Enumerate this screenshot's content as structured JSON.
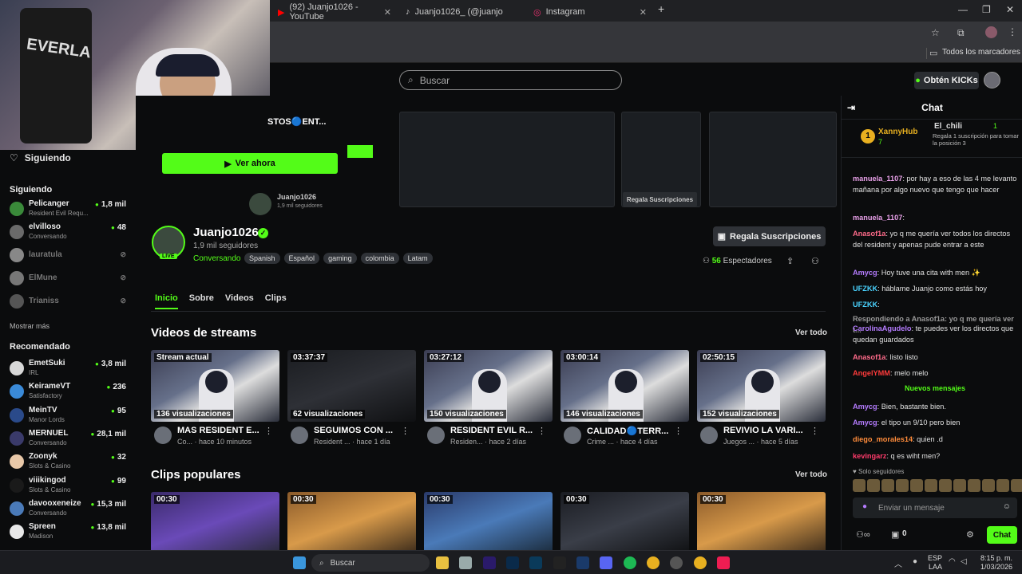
{
  "browser": {
    "tabs": [
      {
        "title": "(92) Juanjo1026 - YouTube",
        "icon": "youtube-icon"
      },
      {
        "title": "Juanjo1026_ (@juanjo1026_) | T",
        "icon": "tiktok-icon"
      },
      {
        "title": "Instagram",
        "icon": "instagram-icon"
      }
    ],
    "bookmarks_label": "Todos los marcadores"
  },
  "topbar": {
    "search_placeholder": "Buscar",
    "get_kicks_label": "Obtén KICKs"
  },
  "banner": {
    "title_fragment": "STOS🔵ENT...",
    "watch_now": "Ver ahora",
    "regala_small": "Regala Suscripciones",
    "small_name": "Juanjo1026",
    "small_followers": "1,9 mil seguidores"
  },
  "sidebar": {
    "siguiendo_header": "Siguiendo",
    "following_title": "Siguiendo",
    "following": [
      {
        "name": "Pelicanger",
        "game": "Resident Evil Requ...",
        "count": "1,8 mil",
        "live": true
      },
      {
        "name": "elvilloso",
        "game": "Conversando",
        "count": "48",
        "live": true
      },
      {
        "name": "lauratula",
        "game": "",
        "count": "",
        "live": false
      },
      {
        "name": "ElMune",
        "game": "",
        "count": "",
        "live": false
      },
      {
        "name": "Trianiss",
        "game": "",
        "count": "",
        "live": false
      }
    ],
    "show_more": "Mostrar más",
    "recommended_title": "Recomendado",
    "recommended": [
      {
        "name": "EmetSuki",
        "game": "IRL",
        "count": "3,8 mil"
      },
      {
        "name": "KeirameVT",
        "game": "Satisfactory",
        "count": "236"
      },
      {
        "name": "MeinTV",
        "game": "Manor Lords",
        "count": "95"
      },
      {
        "name": "MERNUEL",
        "game": "Conversando",
        "count": "28,1 mil"
      },
      {
        "name": "Zoonyk",
        "game": "Slots & Casino",
        "count": "32"
      },
      {
        "name": "viiikingod",
        "game": "Slots & Casino",
        "count": "99"
      },
      {
        "name": "davooxeneize",
        "game": "Conversando",
        "count": "15,3 mil"
      },
      {
        "name": "Spreen",
        "game": "Madison",
        "count": "13,8 mil"
      }
    ]
  },
  "profile": {
    "name": "Juanjo1026",
    "followers": "1,9 mil seguidores",
    "status": "Conversando",
    "live_badge": "LIVE",
    "tags": [
      "Spanish",
      "Español",
      "gaming",
      "colombia",
      "Latam"
    ],
    "regala_btn": "Regala Suscripciones",
    "viewers_count": "56",
    "viewers_label": "Espectadores"
  },
  "tabs": [
    "Inicio",
    "Sobre",
    "Videos",
    "Clips"
  ],
  "videos_section": {
    "title": "Videos de streams",
    "see_all": "Ver todo",
    "items": [
      {
        "badge": "Stream actual",
        "views": "136 visualizaciones",
        "title": "MAS RESIDENT E...",
        "sub": "Co... · hace 10 minutos"
      },
      {
        "badge": "03:37:37",
        "views": "62 visualizaciones",
        "title": "SEGUIMOS CON ...",
        "sub": "Resident ... · hace 1 día"
      },
      {
        "badge": "03:27:12",
        "views": "150 visualizaciones",
        "title": "RESIDENT EVIL R...",
        "sub": "Residen... · hace 2 días"
      },
      {
        "badge": "03:00:14",
        "views": "146 visualizaciones",
        "title": "CALIDAD🔵TERR...",
        "sub": "Crime ... · hace 4 días"
      },
      {
        "badge": "02:50:15",
        "views": "152 visualizaciones",
        "title": "REVIVIO LA VARI...",
        "sub": "Juegos ... · hace 5 días"
      }
    ]
  },
  "clips_section": {
    "title": "Clips populares",
    "see_all": "Ver todo",
    "durations": [
      "00:30",
      "00:30",
      "00:30",
      "00:30",
      "00:30"
    ]
  },
  "chat": {
    "title": "Chat",
    "pinned_user1": "XannyHub",
    "pinned_count1": "7",
    "pinned_user2": "El_chili",
    "pinned_count2": "1",
    "pinned_text": "Regala 1 suscripción para tomar la posición 3",
    "messages": [
      {
        "user": "manuela_1107",
        "color": "#e8a0e8",
        "text": ": por hay a eso de las 4 me levanto mañana por algo nuevo que tengo que hacer"
      },
      {
        "user": "manuela_1107",
        "color": "#e8a0e8",
        "text": ":"
      },
      {
        "user": "Anasof1a",
        "color": "#ff6b8a",
        "text": ": yo q me quería ver todos los directos del resident y apenas pude entrar a este"
      },
      {
        "user": "Amycg",
        "color": "#b57cff",
        "text": ": Hoy tuve una cita with men ✨"
      },
      {
        "user": "UFZKK",
        "color": "#4ad3ff",
        "text": ": háblame Juanjo como estás hoy"
      },
      {
        "user": "UFZKK",
        "color": "#4ad3ff",
        "text": ":"
      },
      {
        "user": "Respondiendo a Anasof1a: yo q me quería ver t...",
        "color": "#999999",
        "text": ""
      },
      {
        "user": "CarolinaAgudelo",
        "color": "#b57cff",
        "text": ": te puedes ver los directos que quedan guardados"
      },
      {
        "user": "Anasof1a",
        "color": "#ff6b8a",
        "text": ": listo listo"
      },
      {
        "user": "AngelYMM",
        "color": "#ff3b3b",
        "text": ": melo melo"
      }
    ],
    "new_messages": "Nuevos mensajes",
    "messages2": [
      {
        "user": "Amycg",
        "color": "#b57cff",
        "text": ": Bien, bastante bien."
      },
      {
        "user": "Amycg",
        "color": "#b57cff",
        "text": ": el tipo un 9/10 pero bien"
      },
      {
        "user": "diego_morales14",
        "color": "#ff8c3b",
        "text": ": quien .d"
      },
      {
        "user": "kevingarz",
        "color": "#ff3b6b",
        "text": ": q es wiht men?"
      }
    ],
    "followers_only": "Solo seguidores",
    "input_placeholder": "Enviar un mensaje",
    "kicks_count": "0",
    "send_label": "Chat"
  },
  "taskbar": {
    "search": "Buscar",
    "lang1": "ESP",
    "lang2": "LAA",
    "time": "8:15 p. m.",
    "date": "1/03/2026"
  }
}
